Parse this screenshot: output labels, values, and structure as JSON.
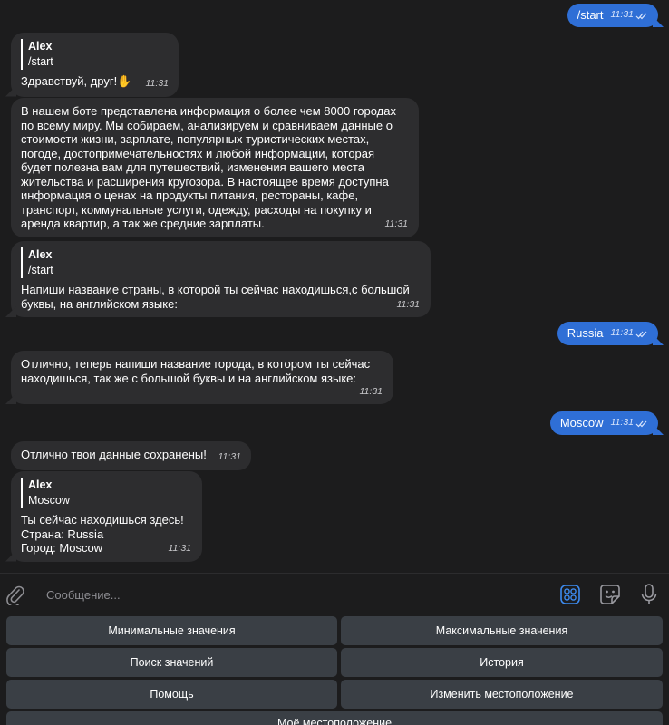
{
  "messages": [
    {
      "id": "m1",
      "dir": "out",
      "text": "/start",
      "time": "11:31"
    },
    {
      "id": "m2",
      "dir": "in",
      "reply_name": "Alex",
      "reply_text": "/start",
      "text": "Здравствуй, друг!✋",
      "time": "11:31"
    },
    {
      "id": "m3",
      "dir": "in",
      "text": "В нашем боте представлена информация о более чем 8000 городах\nпо всему миру. Мы собираем, анализируем и сравниваем данные о\nстоимости жизни, зарплате, популярных туристических местах,\nпогоде, достопримечательностях и любой информации, которая\nбудет полезна вам для путешествий, изменения вашего места\nжительства и расширения кругозора. В настоящее время доступна\nинформация о ценах на продукты питания, рестораны, кафе,\nтранспорт, коммунальные услуги, одежду, расходы на покупку и\nаренда квартир, а так же средние зарплаты.",
      "time": "11:31"
    },
    {
      "id": "m4",
      "dir": "in",
      "reply_name": "Alex",
      "reply_text": "/start",
      "text": "Напиши название страны, в которой ты сейчас находишься,с большой\nбуквы, на английском языке:",
      "time": "11:31"
    },
    {
      "id": "m5",
      "dir": "out",
      "text": "Russia",
      "time": "11:31"
    },
    {
      "id": "m6",
      "dir": "in",
      "text": "Отлично, теперь напиши название города, в котором ты сейчас\nнаходишься, так же с большой буквы и на английском языке:",
      "time": "11:31"
    },
    {
      "id": "m7",
      "dir": "out",
      "text": "Moscow",
      "time": "11:31"
    },
    {
      "id": "m8",
      "dir": "in",
      "text": "Отлично твои данные сохранены!",
      "time": "11:31"
    },
    {
      "id": "m9",
      "dir": "in",
      "reply_name": "Alex",
      "reply_text": "Moscow",
      "text": "Ты сейчас находишься здесь!\nСтрана: Russia\nГород: Moscow",
      "time": "11:31"
    }
  ],
  "input": {
    "placeholder": "Сообщение..."
  },
  "icons": {
    "attach": "paperclip-icon",
    "bot_menu": "bot-commands-icon",
    "sticker": "sticker-icon",
    "mic": "microphone-icon",
    "read": "double-check-icon"
  },
  "keyboard": {
    "buttons": [
      {
        "label": "Минимальные значения"
      },
      {
        "label": "Максимальные значения"
      },
      {
        "label": "Поиск значений"
      },
      {
        "label": "История"
      },
      {
        "label": "Помощь"
      },
      {
        "label": "Изменить местоположение"
      },
      {
        "label": "Моё местоположение"
      }
    ]
  },
  "colors": {
    "background": "#1c1c1d",
    "incoming_bubble": "#2d2d2f",
    "outgoing_bubble": "#2f6fd6",
    "keyboard_button": "#3a3f45",
    "accent": "#3d8bf0"
  }
}
